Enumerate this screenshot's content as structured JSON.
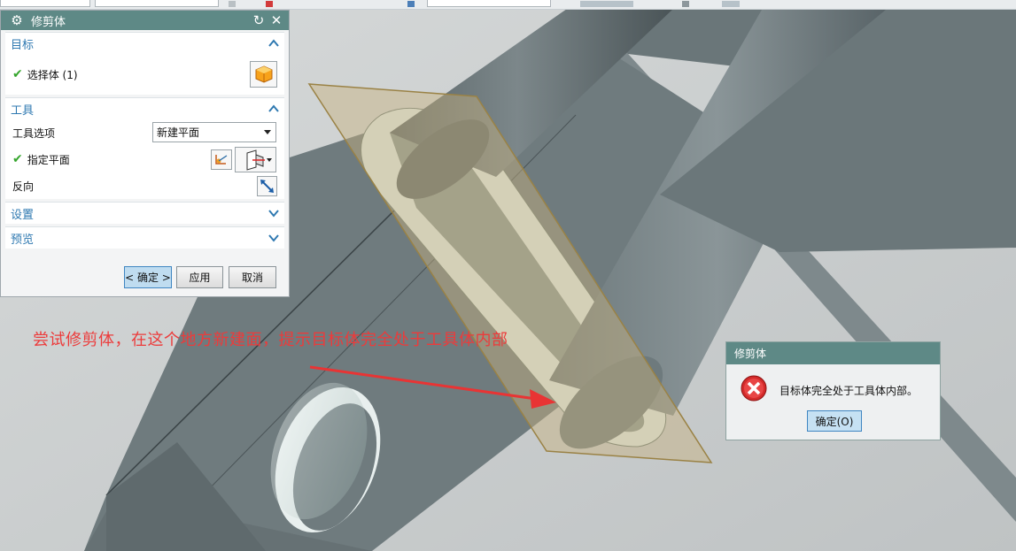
{
  "trim_panel": {
    "title": "修剪体",
    "target_section": {
      "title": "目标",
      "select_body_label": "选择体 (1)"
    },
    "tool_section": {
      "title": "工具",
      "tool_option_label": "工具选项",
      "tool_option_value": "新建平面",
      "specify_plane_label": "指定平面",
      "reverse_label": "反向"
    },
    "settings_section": {
      "title": "设置"
    },
    "preview_section": {
      "title": "预览"
    },
    "buttons": {
      "ok": "< 确定 >",
      "apply": "应用",
      "cancel": "取消"
    }
  },
  "annotation": {
    "text": "尝试修剪体，在这个地方新建面，提示目标体完全处于工具体内部",
    "color": "#ec3b3b"
  },
  "error_dialog": {
    "title": "修剪体",
    "message": "目标体完全处于工具体内部。",
    "ok_button": "确定(O)",
    "icon": "error-icon"
  },
  "colors": {
    "title_bar": "#5e8986",
    "section_heading": "#2f79b1",
    "check": "#35a52d",
    "error": "#d32a2a"
  }
}
